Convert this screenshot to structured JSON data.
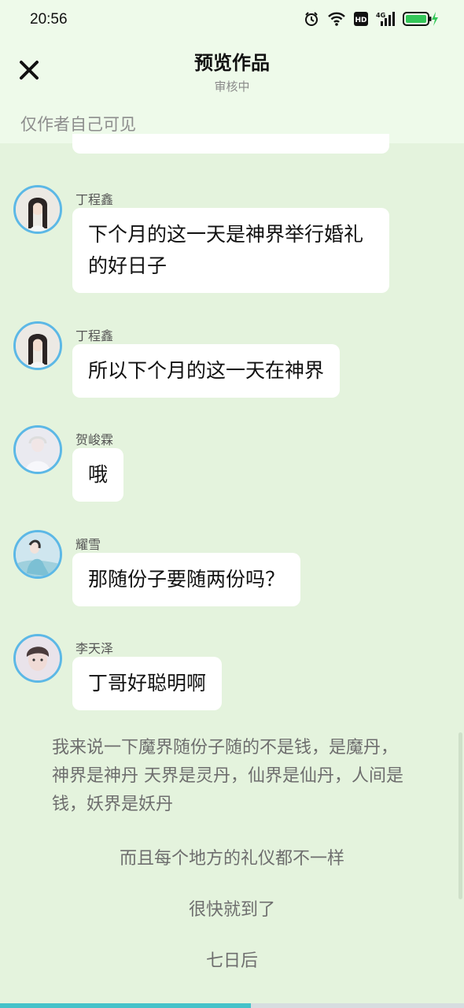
{
  "status_bar": {
    "time": "20:56",
    "icons": [
      "alarm-icon",
      "wifi-icon",
      "hd-icon",
      "4g-signal-icon",
      "battery-charging-icon"
    ],
    "hd_label": "HD",
    "network_label": "4G",
    "battery_color": "#34c759"
  },
  "header": {
    "title": "预览作品",
    "subtitle": "审核中",
    "close_icon": "close-icon"
  },
  "visibility_note": "仅作者自己可见",
  "messages": [
    {
      "sender": "丁程鑫",
      "text": "下个月的这一天是神界举行婚礼的好日子"
    },
    {
      "sender": "丁程鑫",
      "text": "所以下个月的这一天在神界"
    },
    {
      "sender": "贺峻霖",
      "text": "哦"
    },
    {
      "sender": "耀雪",
      "text": "那随份子要随两份吗？"
    },
    {
      "sender": "李天泽",
      "text": "丁哥好聪明啊"
    }
  ],
  "narrations": [
    "我来说一下魔界随份子随的不是钱，是魔丹，神界是神丹 天界是灵丹，仙界是仙丹，人间是钱，妖界是妖丹",
    "而且每个地方的礼仪都不一样",
    "很快就到了",
    "七日后"
  ],
  "reading_progress": 0.54,
  "colors": {
    "background": "#e4f3dd",
    "header_background": "#eefaea",
    "bubble": "#ffffff",
    "avatar_ring": "#5cb8e6",
    "progress": "#45c2c9"
  }
}
